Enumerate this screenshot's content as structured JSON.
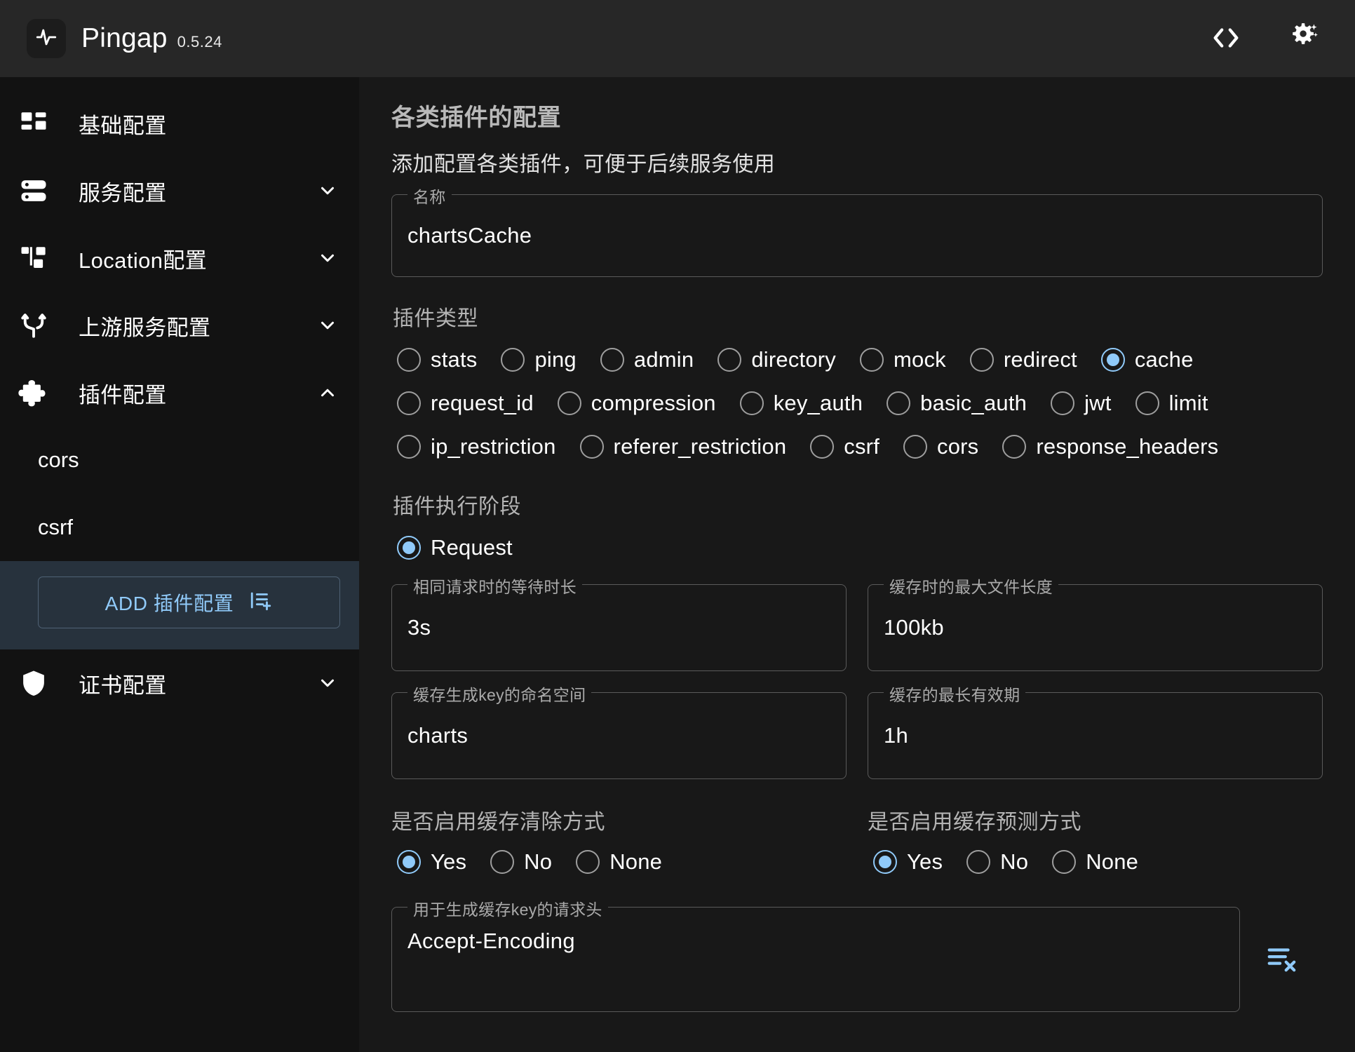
{
  "header": {
    "logo_icon": "activity-pulse-icon",
    "title": "Pingap",
    "version": "0.5.24",
    "actions": [
      {
        "name": "code-brackets-icon",
        "label": "<>"
      },
      {
        "name": "gear-sparkle-icon",
        "label": "settings"
      }
    ]
  },
  "sidebar": {
    "items": [
      {
        "label": "基础配置",
        "icon": "dashboard-icon",
        "expandable": false
      },
      {
        "label": "服务配置",
        "icon": "server-icon",
        "expandable": true,
        "expanded": false
      },
      {
        "label": "Location配置",
        "icon": "network-node-icon",
        "expandable": true,
        "expanded": false
      },
      {
        "label": "上游服务配置",
        "icon": "git-branch-icon",
        "expandable": true,
        "expanded": false
      },
      {
        "label": "插件配置",
        "icon": "puzzle-piece-icon",
        "expandable": true,
        "expanded": true
      },
      {
        "label": "证书配置",
        "icon": "shield-icon",
        "expandable": true,
        "expanded": false
      }
    ],
    "plugin_children": [
      "cors",
      "csrf"
    ],
    "add_button": {
      "label": "ADD 插件配置",
      "icon": "list-plus-icon",
      "accent": "#90caf9"
    }
  },
  "main": {
    "title": "各类插件的配置",
    "subtitle": "添加配置各类插件，可便于后续服务使用",
    "name_field": {
      "legend": "名称",
      "value": "chartsCache"
    },
    "plugin_type": {
      "label": "插件类型",
      "selected": "cache",
      "rows": [
        [
          "stats",
          "ping",
          "admin",
          "directory",
          "mock",
          "redirect",
          "cache"
        ],
        [
          "request_id",
          "compression",
          "key_auth",
          "basic_auth",
          "jwt",
          "limit"
        ],
        [
          "ip_restriction",
          "referer_restriction",
          "csrf",
          "cors",
          "response_headers"
        ]
      ]
    },
    "plugin_stage": {
      "label": "插件执行阶段",
      "options": [
        "Request"
      ],
      "selected": "Request"
    },
    "fields": [
      {
        "legend": "相同请求时的等待时长",
        "value": "3s"
      },
      {
        "legend": "缓存时的最大文件长度",
        "value": "100kb"
      },
      {
        "legend": "缓存生成key的命名空间",
        "value": "charts"
      },
      {
        "legend": "缓存的最长有效期",
        "value": "1h"
      }
    ],
    "toggles": [
      {
        "label": "是否启用缓存清除方式",
        "options": [
          "Yes",
          "No",
          "None"
        ],
        "selected": "Yes"
      },
      {
        "label": "是否启用缓存预测方式",
        "options": [
          "Yes",
          "No",
          "None"
        ],
        "selected": "Yes"
      }
    ],
    "header_field": {
      "legend": "用于生成缓存key的请求头",
      "value": "Accept-Encoding",
      "action_icon": "list-remove-icon"
    }
  },
  "colors": {
    "accent": "#90caf9",
    "header_bg": "#272727",
    "sidebar_bg": "#121212",
    "main_bg": "#181818",
    "highlight_bg": "#27323d"
  }
}
